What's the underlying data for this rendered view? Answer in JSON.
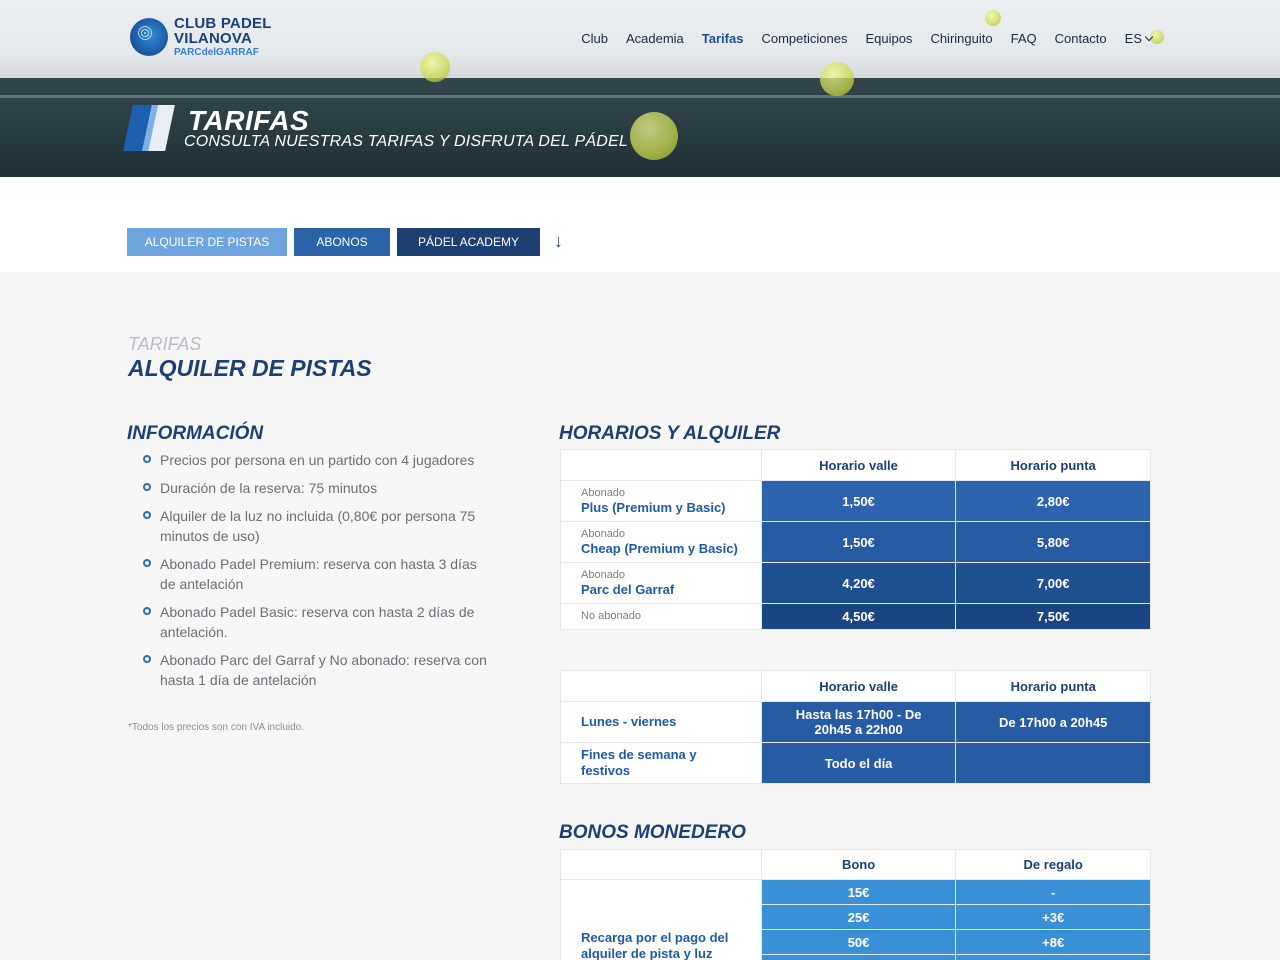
{
  "site": {
    "logo_line1": "CLUB PADEL",
    "logo_line2": "VILANOVA",
    "logo_line3": "PARCdelGARRAF"
  },
  "nav": {
    "items": [
      "Club",
      "Academia",
      "Tarifas",
      "Competiciones",
      "Equipos",
      "Chiringuito",
      "FAQ",
      "Contacto"
    ],
    "active": "Tarifas",
    "lang": "ES"
  },
  "hero": {
    "title": "TARIFAS",
    "subtitle": "CONSULTA NUESTRAS TARIFAS Y DISFRUTA DEL PÁDEL"
  },
  "tabs": {
    "alquiler": "ALQUILER DE PISTAS",
    "abonos": "ABONOS",
    "academy": "PÁDEL ACADEMY",
    "arrow": "↓"
  },
  "section": {
    "kicker": "TARIFAS",
    "title": "ALQUILER DE PISTAS"
  },
  "info": {
    "heading": "INFORMACIÓN",
    "items": [
      "Precios por persona en un partido con 4 jugadores",
      "Duración de la reserva: 75 minutos",
      "Alquiler de la luz no incluida (0,80€ por persona 75 minutos de uso)",
      "Abonado Padel Premium: reserva con hasta 3 días de antelación",
      "Abonado Padel Basic: reserva con hasta 2 días de antelación.",
      "Abonado Parc del Garraf y No abonado: reserva con hasta 1 día de antelación"
    ],
    "footnote": "*Todos los precios son con IVA incluido."
  },
  "horarios": {
    "heading": "HORARIOS Y ALQUILER",
    "col1": "Horario valle",
    "col2": "Horario punta",
    "rows": [
      {
        "small": "Abonado",
        "strong": "Plus (Premium y Basic)",
        "v1": "1,50€",
        "v2": "2,80€"
      },
      {
        "small": "Abonado",
        "strong": "Cheap (Premium y Basic)",
        "v1": "1,50€",
        "v2": "5,80€"
      },
      {
        "small": "Abonado",
        "strong": "Parc del Garraf",
        "v1": "4,20€",
        "v2": "7,00€"
      },
      {
        "small": "No abonado",
        "strong": "",
        "v1": "4,50€",
        "v2": "7,50€"
      }
    ]
  },
  "schedule": {
    "col1": "Horario valle",
    "col2": "Horario punta",
    "rows": [
      {
        "label": "Lunes - viernes",
        "v1": "Hasta las 17h00 - De 20h45 a 22h00",
        "v2": "De 17h00 a 20h45"
      },
      {
        "label": "Fines de semana y festivos",
        "v1": "Todo el día",
        "v2": ""
      }
    ]
  },
  "bonos": {
    "heading": "BONOS MONEDERO",
    "col1": "Bono",
    "col2": "De regalo",
    "label": "Recarga por el pago del alquiler de pista y luz",
    "rows": [
      {
        "v1": "15€",
        "v2": "-"
      },
      {
        "v1": "25€",
        "v2": "+3€"
      },
      {
        "v1": "50€",
        "v2": "+8€"
      }
    ]
  }
}
